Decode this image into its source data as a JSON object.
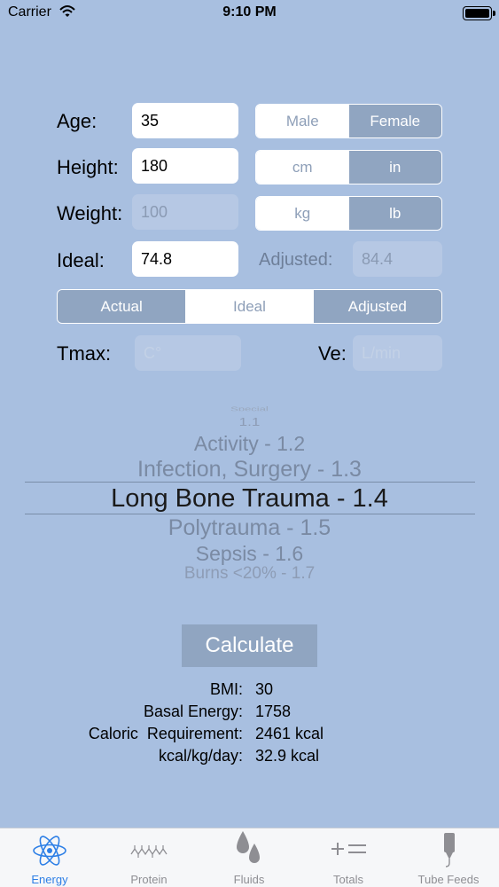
{
  "status_bar": {
    "carrier": "Carrier",
    "time": "9:10 PM",
    "battery_level": 1.0
  },
  "form": {
    "age_label": "Age:",
    "age_value": "35",
    "height_label": "Height:",
    "height_value": "180",
    "weight_label": "Weight:",
    "weight_placeholder": "100",
    "ideal_label": "Ideal:",
    "ideal_value": "74.8",
    "adjusted_label": "Adjusted:",
    "adjusted_value": "84.4",
    "sex_options": [
      "Male",
      "Female"
    ],
    "sex_selected": "Female",
    "height_unit_options": [
      "cm",
      "in"
    ],
    "height_unit_selected": "in",
    "weight_unit_options": [
      "kg",
      "lb"
    ],
    "weight_unit_selected": "lb",
    "weight_basis_options": [
      "Actual",
      "Ideal",
      "Adjusted"
    ],
    "weight_basis_selected": "Ideal",
    "tmax_label": "Tmax:",
    "tmax_placeholder": "C°",
    "ve_label": "Ve:",
    "ve_placeholder": "L/min"
  },
  "picker": {
    "items": [
      "1.1",
      "Activity - 1.2",
      "Infection, Surgery - 1.3",
      "Long Bone Trauma - 1.4",
      "Polytrauma - 1.5",
      "Sepsis - 1.6",
      "Burns <20% - 1.7"
    ],
    "selected": "Long Bone Trauma - 1.4"
  },
  "calculate_label": "Calculate",
  "results": [
    {
      "label": "BMI:",
      "value": "30"
    },
    {
      "label": "Basal Energy:",
      "value": "1758"
    },
    {
      "label": "Caloric  Requirement:",
      "value": "2461 kcal"
    },
    {
      "label": "kcal/kg/day:",
      "value": "32.9 kcal"
    }
  ],
  "tabs": [
    {
      "label": "Energy",
      "icon": "atom-icon",
      "active": true
    },
    {
      "label": "Protein",
      "icon": "molecule-chain-icon",
      "active": false
    },
    {
      "label": "Fluids",
      "icon": "droplets-icon",
      "active": false
    },
    {
      "label": "Totals",
      "icon": "plus-equals-icon",
      "active": false
    },
    {
      "label": "Tube Feeds",
      "icon": "feeding-tube-icon",
      "active": false
    }
  ],
  "colors": {
    "background": "#a8bfe0",
    "segment_selected": "#90a5c1",
    "tab_active": "#2d7fe6"
  }
}
